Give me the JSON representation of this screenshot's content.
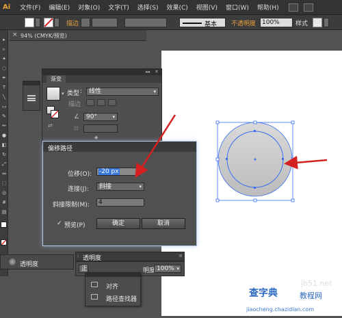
{
  "app": {
    "logo": "Ai",
    "menu": [
      "文件(F)",
      "编辑(E)",
      "对象(O)",
      "文字(T)",
      "选择(S)",
      "效果(C)",
      "视图(V)",
      "窗口(W)",
      "帮助(H)"
    ]
  },
  "control_bar": {
    "stroke_label": "描边",
    "stroke_style": "基本",
    "opacity_label": "不透明度",
    "opacity_value": "100%",
    "style_label": "样式"
  },
  "document": {
    "tab_close": "×",
    "tab_title": "94% (CMYK/预览)"
  },
  "gradient_panel": {
    "tab": "渐变",
    "type_label": "类型",
    "type_value": "线性",
    "stroke_label": "描边",
    "angle_value": "90°"
  },
  "offset_dialog": {
    "title": "偏移路径",
    "offset_label": "位移(O):",
    "offset_value": "-20 px",
    "joins_label": "连接(J):",
    "joins_value": "斜接",
    "miter_label": "斜接限制(M):",
    "miter_value": "4",
    "preview_check": "✓",
    "preview_label": "预览(P)",
    "ok_label": "确定",
    "cancel_label": "取消"
  },
  "bottom_panels": {
    "transparency_left": "透明度",
    "transparency_tab": "透明度",
    "transparency_mode": "正",
    "opacity_label": "明度:",
    "opacity_value": "100%",
    "flyout_items": [
      "对齐",
      "路径查找器"
    ]
  },
  "watermark": {
    "line1": "查字典",
    "line2": "教程网",
    "line3": "jiaocheng.chazidian.com",
    "domain": "jb51.net"
  },
  "colors": {
    "arrow": "#d42020",
    "selection": "#3a6ff0",
    "circle_fill_top": "#d9d9d9",
    "circle_fill_bottom": "#bcbcbc",
    "input_highlight": "#3a78d8"
  }
}
